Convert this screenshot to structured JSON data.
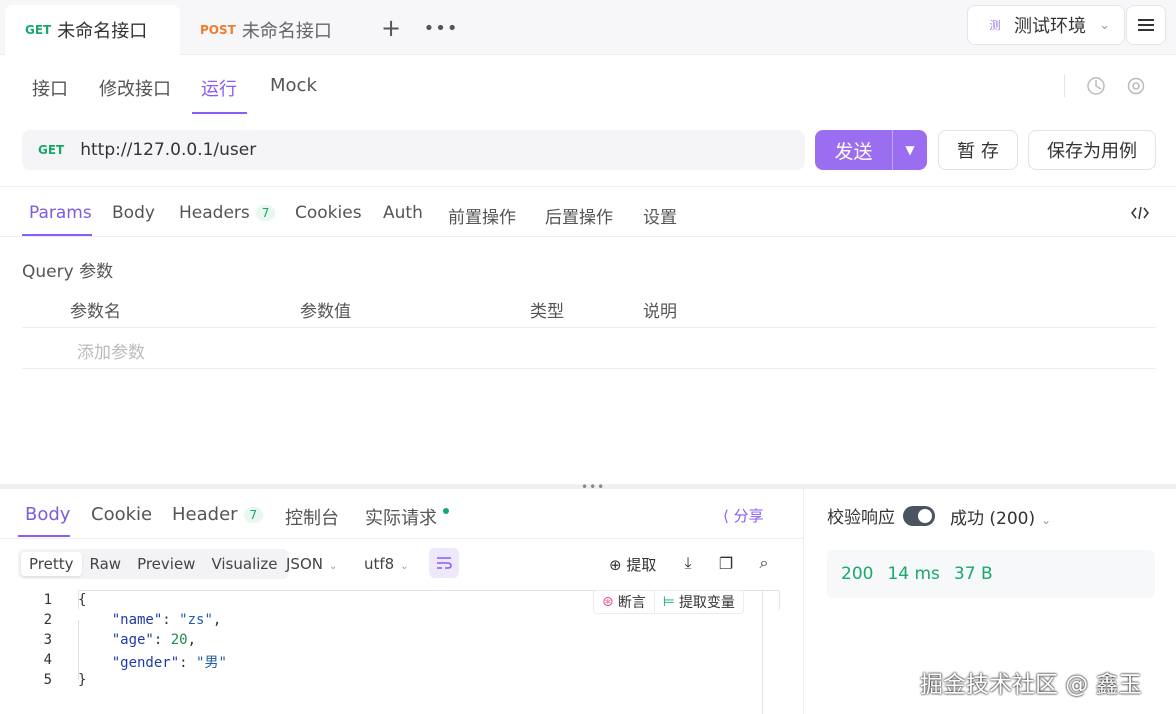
{
  "tabs": [
    {
      "method": "GET",
      "title": "未命名接口"
    },
    {
      "method": "POST",
      "title": "未命名接口"
    }
  ],
  "env": {
    "badge": "测",
    "label": "测试环境"
  },
  "mode_tabs": [
    "接口",
    "修改接口",
    "运行",
    "Mock"
  ],
  "request": {
    "method": "GET",
    "url": "http://127.0.0.1/user"
  },
  "buttons": {
    "send": "发送",
    "save_temp": "暂 存",
    "save_case": "保存为用例"
  },
  "req_tabs": [
    "Params",
    "Body",
    "Headers",
    "Cookies",
    "Auth",
    "前置操作",
    "后置操作",
    "设置"
  ],
  "headers_count": "7",
  "params": {
    "section_title": "Query 参数",
    "columns": [
      "参数名",
      "参数值",
      "类型",
      "说明"
    ],
    "add_placeholder": "添加参数"
  },
  "response": {
    "tabs": [
      "Body",
      "Cookie",
      "Header",
      "控制台",
      "实际请求"
    ],
    "header_count": "7",
    "share": "分享",
    "formats": [
      "Pretty",
      "Raw",
      "Preview",
      "Visualize"
    ],
    "lang": "JSON",
    "encoding": "utf8",
    "extract": "提取",
    "assert_chip": "断言",
    "extract_var_chip": "提取变量",
    "line_numbers": [
      "1",
      "2",
      "3",
      "4",
      "5"
    ],
    "body": {
      "name": "zs",
      "age": 20,
      "gender": "男"
    }
  },
  "validate_label": "校验响应",
  "validate_result": "成功 (200)",
  "status": {
    "code": "200",
    "time": "14 ms",
    "size": "37 B"
  },
  "watermark": "掘金技术社区 @ 鑫玉",
  "colors": {
    "accent": "#8b5cf6",
    "get": "#17a96b",
    "post": "#ef7c2f"
  }
}
